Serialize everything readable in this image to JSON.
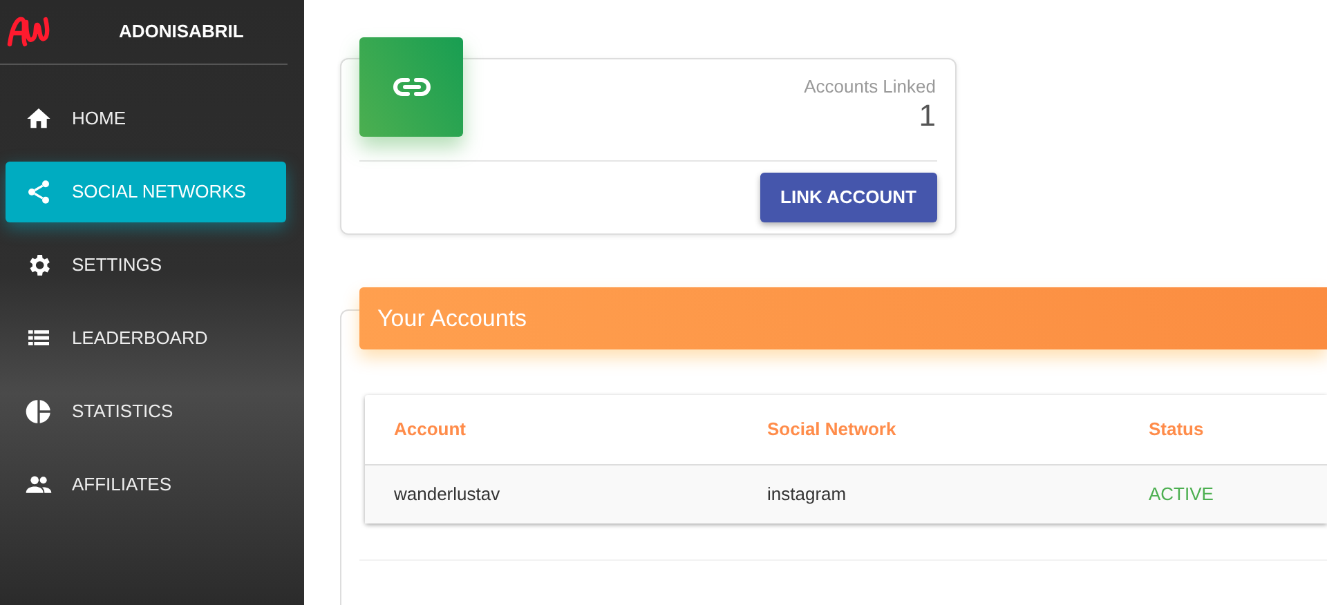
{
  "sidebar": {
    "brand": "ADONISABRIL",
    "items": [
      {
        "label": "HOME",
        "selected": false
      },
      {
        "label": "SOCIAL NETWORKS",
        "selected": true
      },
      {
        "label": "SETTINGS",
        "selected": false
      },
      {
        "label": "LEADERBOARD",
        "selected": false
      },
      {
        "label": "STATISTICS",
        "selected": false
      },
      {
        "label": "AFFILIATES",
        "selected": false
      }
    ]
  },
  "stat_card": {
    "label": "Accounts Linked",
    "value": "1",
    "button": "LINK ACCOUNT"
  },
  "accounts": {
    "title": "Your Accounts",
    "columns": [
      "Account",
      "Social Network",
      "Status"
    ],
    "rows": [
      {
        "cells": [
          "wanderlustav",
          "instagram",
          "ACTIVE"
        ]
      }
    ]
  }
}
